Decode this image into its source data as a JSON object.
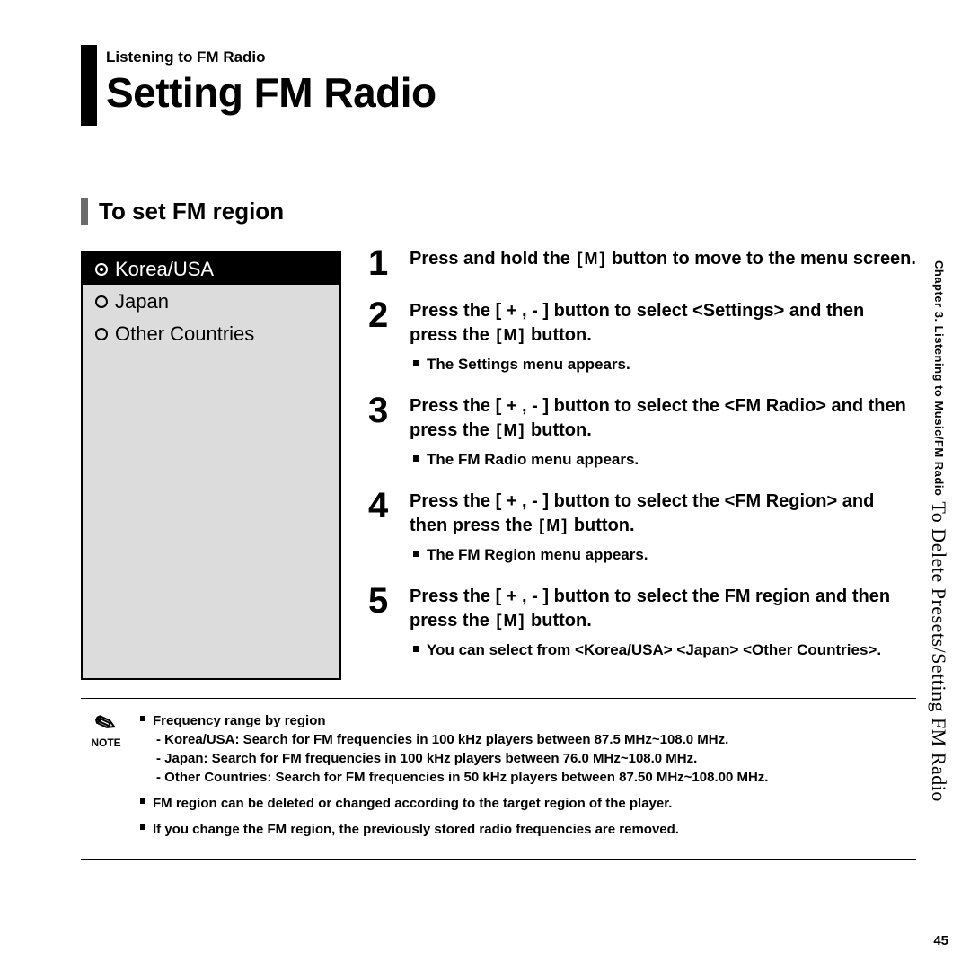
{
  "header": {
    "breadcrumb": "Listening to FM Radio",
    "title": "Setting FM Radio"
  },
  "section_title": "To set FM region",
  "region_options": [
    {
      "label": "Korea/USA",
      "selected": true
    },
    {
      "label": "Japan",
      "selected": false
    },
    {
      "label": "Other Countries",
      "selected": false
    }
  ],
  "steps": [
    {
      "n": "1",
      "text_before": "Press and hold the ",
      "text_after": " button to move to the menu screen."
    },
    {
      "n": "2",
      "text_before": "Press the [ + , - ] button to select <Settings> and then press the ",
      "text_after": " button.",
      "sub": "The Settings menu appears."
    },
    {
      "n": "3",
      "text_before": "Press the [ + , - ] button to select the <FM Radio> and then press the ",
      "text_after": " button.",
      "sub": "The FM Radio menu appears."
    },
    {
      "n": "4",
      "text_before": "Press the [ + , - ] button to select the <FM Region> and then press the ",
      "text_after": " button.",
      "sub": "The FM Region menu appears."
    },
    {
      "n": "5",
      "text_before": "Press the [ + , - ] button to select the FM region and then press the ",
      "text_after": " button.",
      "sub": "You can select from <Korea/USA> <Japan> <Other Countries>."
    }
  ],
  "m_label": "M",
  "note": {
    "label": "NOTE",
    "items": [
      {
        "head": "Frequency range by region",
        "lines": [
          "- Korea/USA: Search for FM frequencies in 100 kHz players between 87.5 MHz~108.0 MHz.",
          "- Japan: Search for FM frequencies in 100 kHz players between 76.0 MHz~108.0 MHz.",
          "- Other Countries: Search for FM frequencies in 50 kHz players between 87.50 MHz~108.00 MHz."
        ]
      },
      {
        "head": "FM region can be deleted or changed according to the target region of the player."
      },
      {
        "head": "If you change the FM region, the previously stored radio frequencies are removed."
      }
    ]
  },
  "side": {
    "chapter": "Chapter 3.  Listening to Music/FM Radio",
    "section": "To Delete Presets/Setting FM Radio"
  },
  "page_number": "45"
}
